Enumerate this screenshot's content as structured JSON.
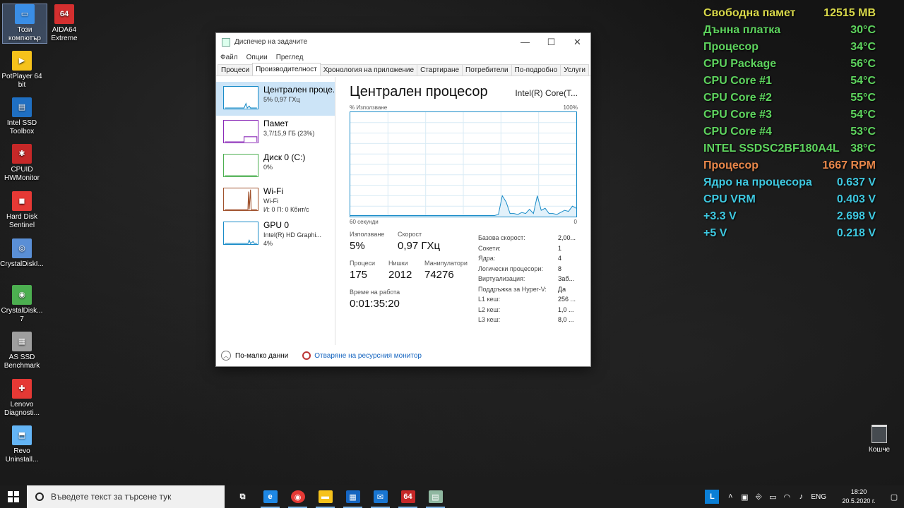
{
  "desktop_icons": [
    {
      "label": "Този компютър",
      "icon": "computer-icon",
      "color": "#3a8ee6",
      "glyph": "▭",
      "selected": true
    },
    {
      "label": "AIDA64 Extreme",
      "icon": "aida64-icon",
      "color": "#d32f2f",
      "glyph": "64"
    },
    {
      "label": "PotPlayer 64 bit",
      "icon": "potplayer-icon",
      "color": "#f6c21b",
      "glyph": "▶"
    },
    {
      "label": "Intel SSD Toolbox",
      "icon": "intel-ssd-icon",
      "color": "#1f6fc2",
      "glyph": "▤"
    },
    {
      "label": "CPUID HWMonitor",
      "icon": "hwmonitor-icon",
      "color": "#c62828",
      "glyph": "✱"
    },
    {
      "label": "Hard Disk Sentinel",
      "icon": "hd-sentinel-icon",
      "color": "#e53935",
      "glyph": "◼"
    },
    {
      "label": "CrystalDiskI...",
      "icon": "crystaldiskinfo-icon",
      "color": "#5a8fd6",
      "glyph": "◎"
    },
    {
      "label": "CrystalDisk... 7",
      "icon": "crystaldiskmark-icon",
      "color": "#4caf50",
      "glyph": "◉"
    },
    {
      "label": "AS SSD Benchmark",
      "icon": "as-ssd-icon",
      "color": "#9e9e9e",
      "glyph": "▦"
    },
    {
      "label": "Lenovo Diagnosti...",
      "icon": "lenovo-diagnostics-icon",
      "color": "#e53935",
      "glyph": "✚"
    },
    {
      "label": "Revo Uninstall...",
      "icon": "revo-uninstaller-icon",
      "color": "#64b5f6",
      "glyph": "⬒"
    }
  ],
  "sensors": [
    {
      "label": "Свободна памет",
      "value": "12515 MB",
      "color": "#d9d94a"
    },
    {
      "label": "Дънна платка",
      "value": "30°C",
      "color": "#5ed45e"
    },
    {
      "label": "Процесор",
      "value": "34°C",
      "color": "#5ed45e"
    },
    {
      "label": "CPU Package",
      "value": "56°C",
      "color": "#5ed45e"
    },
    {
      "label": "CPU Core #1",
      "value": "54°C",
      "color": "#5ed45e"
    },
    {
      "label": "CPU Core #2",
      "value": "55°C",
      "color": "#5ed45e"
    },
    {
      "label": "CPU Core #3",
      "value": "54°C",
      "color": "#5ed45e"
    },
    {
      "label": "CPU Core #4",
      "value": "53°C",
      "color": "#5ed45e"
    },
    {
      "label": "INTEL SSDSC2BF180A4L",
      "value": "38°C",
      "color": "#5ed45e"
    },
    {
      "label": "Процесор",
      "value": "1667 RPM",
      "color": "#e8874a"
    },
    {
      "label": "Ядро на процесора",
      "value": "0.637 V",
      "color": "#3ec8e0"
    },
    {
      "label": "CPU VRM",
      "value": "0.403 V",
      "color": "#3ec8e0"
    },
    {
      "label": "+3.3 V",
      "value": "2.698 V",
      "color": "#3ec8e0"
    },
    {
      "label": "+5 V",
      "value": "0.218 V",
      "color": "#3ec8e0"
    }
  ],
  "taskmgr": {
    "title": "Диспечер на задачите",
    "menu": [
      "Файл",
      "Опции",
      "Преглед"
    ],
    "tabs": [
      "Процеси",
      "Производителност",
      "Хронология на приложение",
      "Стартиране",
      "Потребители",
      "По-подробно",
      "Услуги"
    ],
    "active_tab": 1,
    "resources": [
      {
        "name": "Централен проце...",
        "line1": "5% 0,97 ГХц",
        "line2": "",
        "color": "#1a8cc8",
        "active": true
      },
      {
        "name": "Памет",
        "line1": "3,7/15,9 ГБ (23%)",
        "line2": "",
        "color": "#8b2bb8"
      },
      {
        "name": "Диск 0 (C:)",
        "line1": "0%",
        "line2": "",
        "color": "#4caf50"
      },
      {
        "name": "Wi-Fi",
        "line1": "Wi-Fi",
        "line2": "И: 0 П: 0 Кбит/с",
        "color": "#a0522d"
      },
      {
        "name": "GPU 0",
        "line1": "Intel(R) HD Graphi...",
        "line2": "4%",
        "color": "#1a8cc8"
      }
    ],
    "header": {
      "title": "Централен процесор",
      "model": "Intel(R) Core(T..."
    },
    "graph": {
      "top_left": "% Използване",
      "top_right": "100%",
      "bottom_left": "60 секунди",
      "bottom_right": "0"
    },
    "stats": {
      "utilization_label": "Използване",
      "utilization": "5%",
      "speed_label": "Скорост",
      "speed": "0,97 ГХц",
      "processes_label": "Процеси",
      "processes": "175",
      "threads_label": "Нишки",
      "threads": "2012",
      "handles_label": "Манипулатори",
      "handles": "74276",
      "uptime_label": "Време на работа",
      "uptime": "0:01:35:20"
    },
    "specs": [
      {
        "k": "Базова скорост:",
        "v": "2,00..."
      },
      {
        "k": "Сокети:",
        "v": "1"
      },
      {
        "k": "Ядра:",
        "v": "4"
      },
      {
        "k": "Логически процесори:",
        "v": "8"
      },
      {
        "k": "Виртуализация:",
        "v": "Заб..."
      },
      {
        "k": "Поддръжка за Hyper-V:",
        "v": "Да"
      },
      {
        "k": "L1 кеш:",
        "v": "256 ..."
      },
      {
        "k": "L2 кеш:",
        "v": "1,0 ..."
      },
      {
        "k": "L3 кеш:",
        "v": "8,0 ..."
      }
    ],
    "footer": {
      "less": "По-малко данни",
      "monitor": "Отваряне на ресурсния монитор"
    }
  },
  "recycle_bin": {
    "label": "Кошче"
  },
  "taskbar": {
    "search_placeholder": "Въведете текст за търсене тук",
    "apps": [
      {
        "name": "task-view-icon",
        "glyph": "⧉",
        "color": "#1c1c1c"
      },
      {
        "name": "edge-icon",
        "glyph": "e",
        "color": "#1e88e5"
      },
      {
        "name": "chrome-icon",
        "glyph": "◉",
        "color": "#e53935"
      },
      {
        "name": "explorer-icon",
        "glyph": "▬",
        "color": "#f6c21b"
      },
      {
        "name": "store-icon",
        "glyph": "▦",
        "color": "#1565c0"
      },
      {
        "name": "mail-icon",
        "glyph": "✉",
        "color": "#1976d2"
      },
      {
        "name": "aida64-taskbar-icon",
        "glyph": "64",
        "color": "#c62828"
      },
      {
        "name": "taskmgr-taskbar-icon",
        "glyph": "▤",
        "color": "#8fb7a0"
      }
    ],
    "tray": {
      "lang": "ENG",
      "time": "18:20",
      "date": "20.5.2020 г."
    }
  }
}
